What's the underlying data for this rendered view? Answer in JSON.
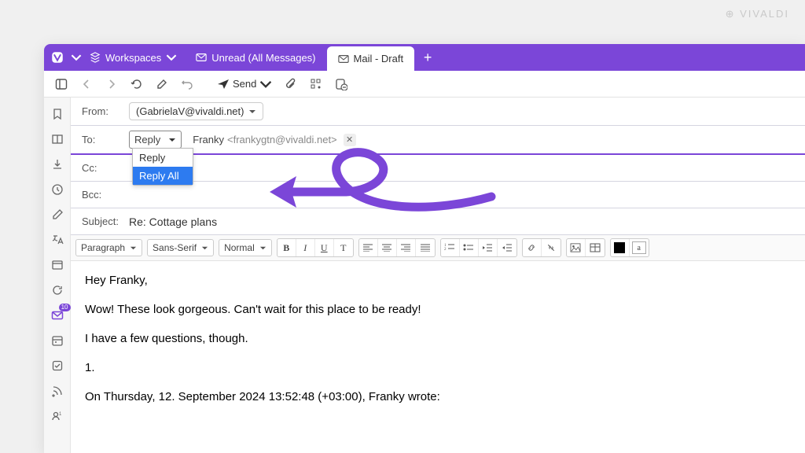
{
  "brand": "VIVALDI",
  "tabstrip": {
    "workspaces_label": "Workspaces",
    "tab1_label": "Unread (All Messages)",
    "tab2_label": "Mail - Draft"
  },
  "toolbar": {
    "send_label": "Send"
  },
  "sidebar": {
    "mail_badge": "10"
  },
  "headers": {
    "from_label": "From:",
    "from_value": "(GabrielaV@vivaldi.net)",
    "to_label": "To:",
    "reply_selected": "Reply",
    "recipient_name": "Franky",
    "recipient_addr": "<frankygtn@vivaldi.net>",
    "cc_label": "Cc:",
    "bcc_label": "Bcc:",
    "subject_label": "Subject:",
    "subject_value": "Re: Cottage plans"
  },
  "dropdown": {
    "opt1": "Reply",
    "opt2": "Reply All"
  },
  "format": {
    "paragraph": "Paragraph",
    "font": "Sans-Serif",
    "size": "Normal"
  },
  "body": {
    "p1": "Hey Franky,",
    "p2": "Wow! These look gorgeous. Can't wait for this place to be ready!",
    "p3": "I have a few questions, though.",
    "p4": "1.",
    "p5": "On Thursday, 12. September 2024 13:52:48 (+03:00), Franky wrote:"
  }
}
